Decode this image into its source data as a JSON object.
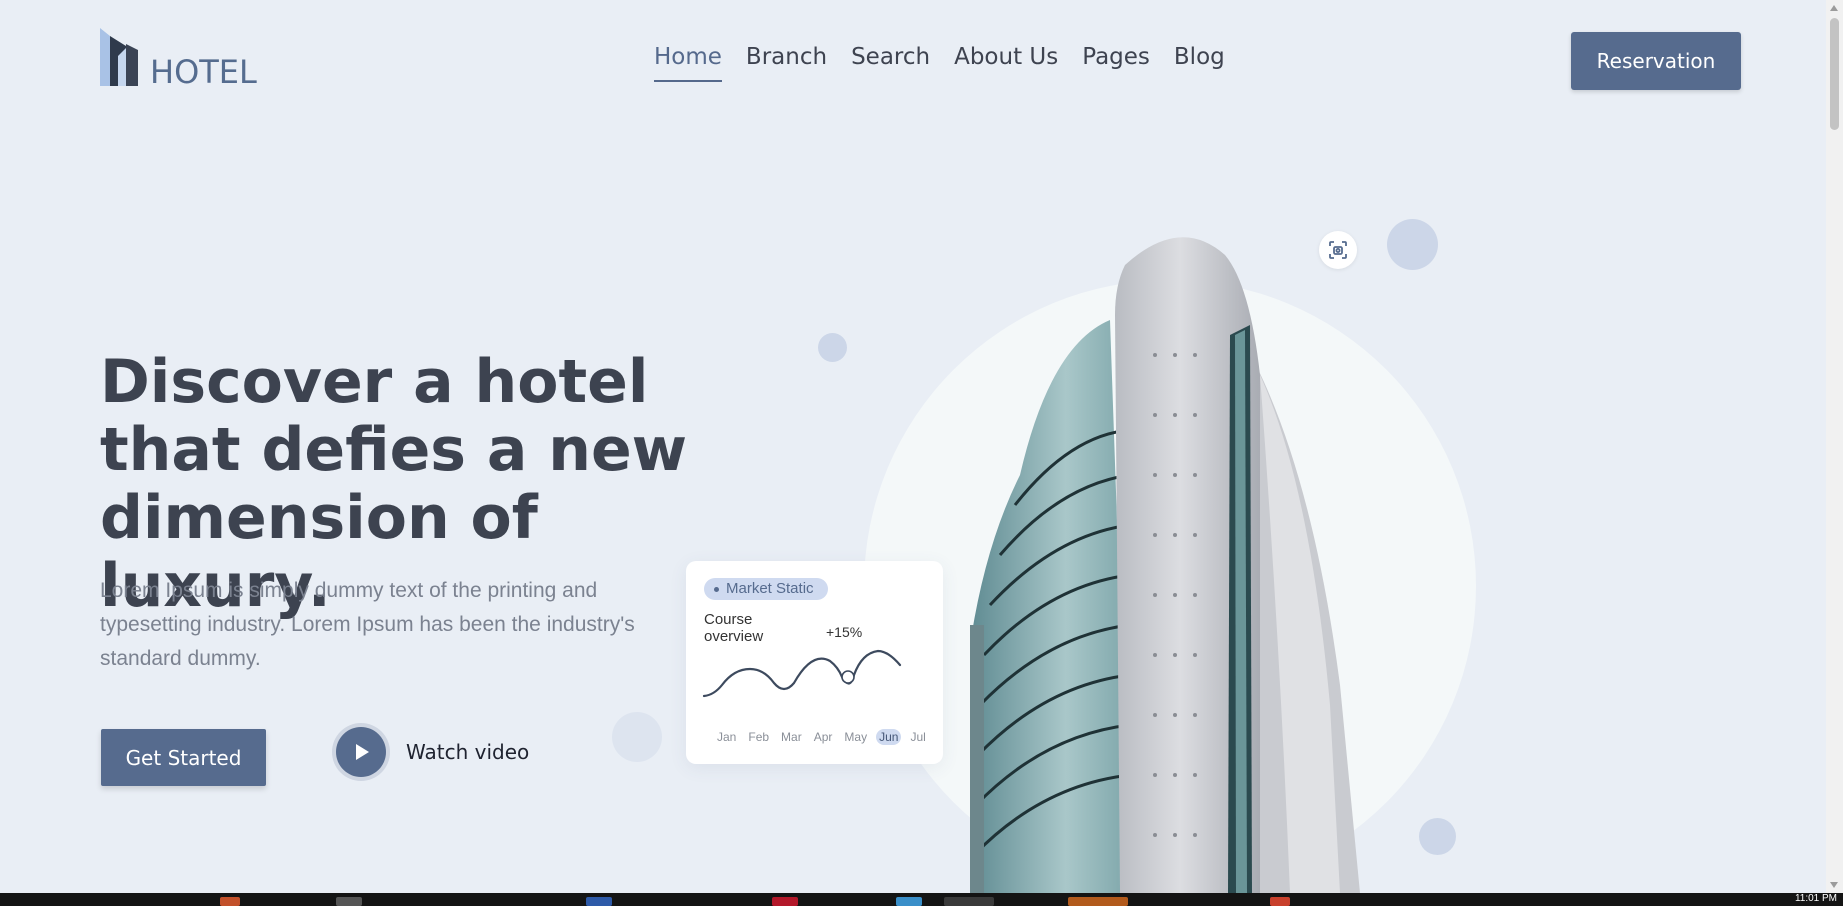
{
  "brand": {
    "name": "HOTEL"
  },
  "nav": {
    "items": [
      "Home",
      "Branch",
      "Search",
      "About Us",
      "Pages",
      "Blog"
    ],
    "active": "Home"
  },
  "header": {
    "reservation_label": "Reservation"
  },
  "hero": {
    "title_lines": [
      "Discover a hotel",
      "that defies a new",
      "dimension of luxury."
    ],
    "description": "Lorem Ipsum is simply dummy text of the printing and typesetting industry. Lorem Ipsum has been the industry's standard dummy.",
    "primary_cta": "Get Started",
    "video_cta": "Watch video"
  },
  "stat_card": {
    "badge": "Market Static",
    "heading": "Course overview",
    "change": "+15%",
    "months": [
      "Jan",
      "Feb",
      "Mar",
      "Apr",
      "May",
      "Jun",
      "Jul"
    ],
    "selected_month": "Jun"
  },
  "icons": {
    "logo": "hotel-building-logo-icon",
    "play": "play-icon",
    "scan": "scan-icon"
  },
  "colors": {
    "background": "#e9eef5",
    "accent": "#566b8e",
    "heading": "#3d4350",
    "muted_text": "#7b8290",
    "pill": "#cfdaf0"
  },
  "taskbar": {
    "clock": "11:01 PM"
  }
}
